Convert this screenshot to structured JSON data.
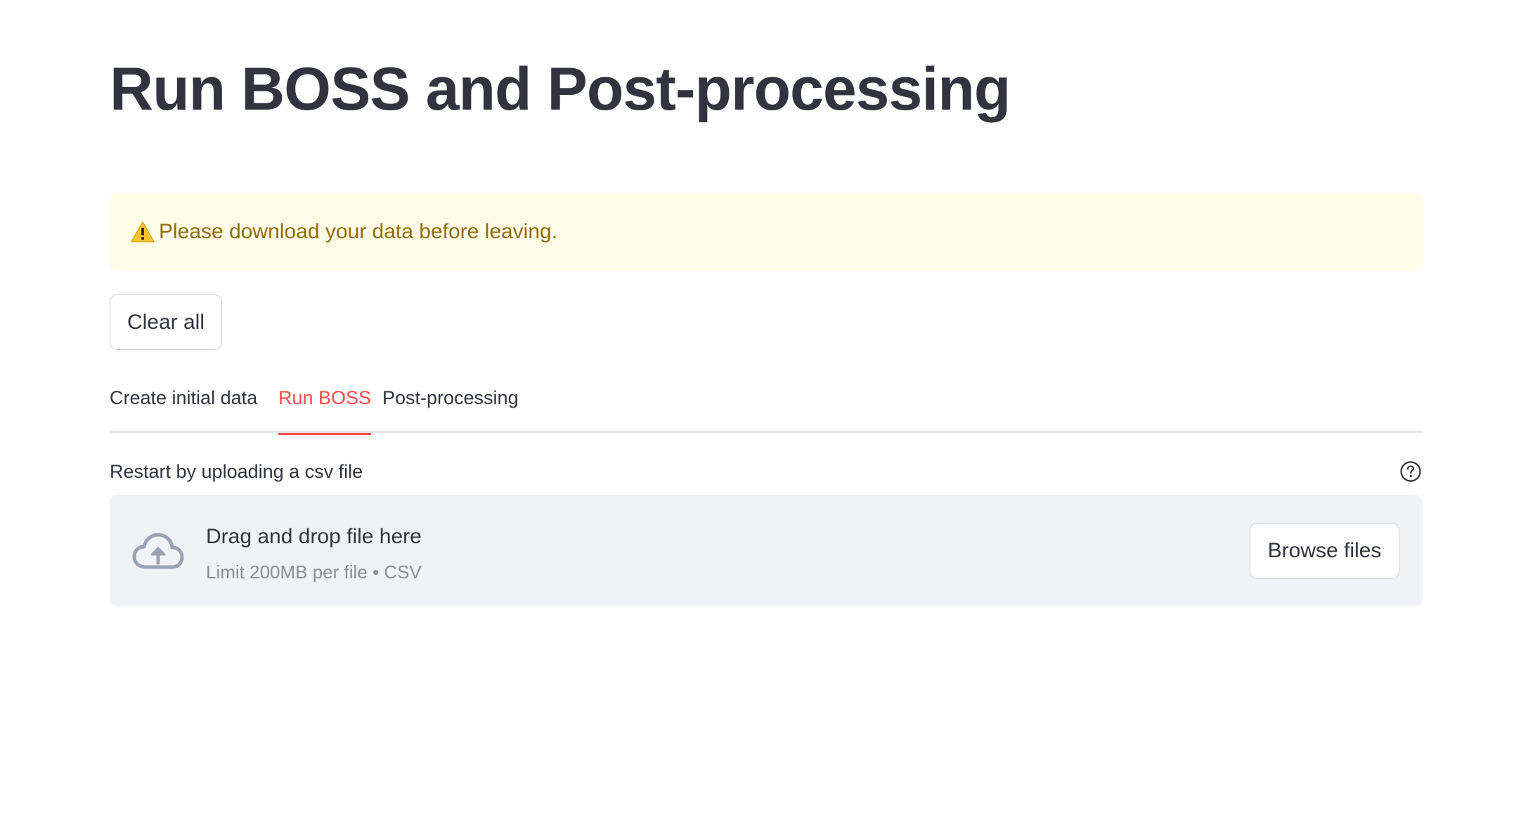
{
  "page": {
    "title": "Run BOSS and Post-processing"
  },
  "alert": {
    "icon": "warning-icon",
    "text": "Please download your data before leaving.",
    "text_color": "#926c05",
    "background": "#fffce7"
  },
  "actions": {
    "clear_label": "Clear all"
  },
  "tabs": [
    {
      "label": "Create initial data",
      "active": false
    },
    {
      "label": "Run BOSS",
      "active": true
    },
    {
      "label": "Post-processing",
      "active": false
    }
  ],
  "accent_color": "#ff4b4b",
  "uploader": {
    "label": "Restart by uploading a csv file",
    "help_icon": "question-circle-icon",
    "cloud_icon": "cloud-upload-icon",
    "drop_text": "Drag and drop file here",
    "limit_text": "Limit 200MB per file • CSV",
    "browse_label": "Browse files"
  }
}
